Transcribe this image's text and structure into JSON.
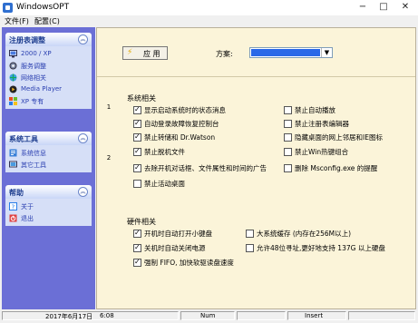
{
  "window": {
    "title": "WindowsOPT",
    "minimize": "−",
    "maximize": "□",
    "close": "✕"
  },
  "menu": {
    "file": "文件(F)",
    "config": "配置(C)"
  },
  "sidebar": {
    "panels": [
      {
        "title": "注册表调整",
        "items": [
          {
            "label": "2000 / XP",
            "icon": "monitor-icon"
          },
          {
            "label": "服务调整",
            "icon": "gear-icon"
          },
          {
            "label": "网络相关",
            "icon": "network-icon"
          },
          {
            "label": "Media Player",
            "icon": "media-icon"
          },
          {
            "label": "XP 专有",
            "icon": "xp-icon"
          }
        ]
      },
      {
        "title": "系统工具",
        "items": [
          {
            "label": "系统信息",
            "icon": "info-icon"
          },
          {
            "label": "其它工具",
            "icon": "tools-icon"
          }
        ]
      },
      {
        "title": "帮助",
        "items": [
          {
            "label": "关于",
            "icon": "help-icon"
          },
          {
            "label": "退出",
            "icon": "exit-icon"
          }
        ]
      }
    ]
  },
  "toolbar": {
    "apply_label": "应 用",
    "scheme_label": "方案:"
  },
  "tabs": {
    "tab1": "1",
    "tab2": "2"
  },
  "system": {
    "title": "系统相关",
    "left": [
      {
        "label": "显示启动系统时的状态消息",
        "checked": true
      },
      {
        "label": "自动登录故障恢复控制台",
        "checked": true
      },
      {
        "label": "禁止转储和 Dr.Watson",
        "checked": true
      },
      {
        "label": "禁止脱机文件",
        "checked": true
      },
      {
        "label": "去除开机对话框、文件属性和时间的广告",
        "checked": true
      },
      {
        "label": "禁止活动桌面",
        "checked": false
      }
    ],
    "right": [
      {
        "label": "禁止自动播放",
        "checked": false
      },
      {
        "label": "禁止注册表编辑器",
        "checked": false
      },
      {
        "label": "隐藏桌面的网上邻居和IE图标",
        "checked": false
      },
      {
        "label": "禁止Win热键组合",
        "checked": false
      },
      {
        "label": "删除 Msconfig.exe 的提醒",
        "checked": false
      }
    ]
  },
  "hardware": {
    "title": "硬件相关",
    "left": [
      {
        "label": "开机时自动打开小键盘",
        "checked": true
      },
      {
        "label": "关机时自动关闭电源",
        "checked": true
      },
      {
        "label": "强制 FIFO, 加快软驱读盘速度",
        "checked": true
      }
    ],
    "right": [
      {
        "label": "大系统缓存 (内存在256M以上)",
        "checked": false
      },
      {
        "label": "允许48位寻址,更好地支持 137G 以上硬盘",
        "checked": false
      }
    ]
  },
  "status": {
    "date": "2017年6月17日",
    "time": "6:08",
    "num": "Num",
    "insert": "Insert"
  }
}
